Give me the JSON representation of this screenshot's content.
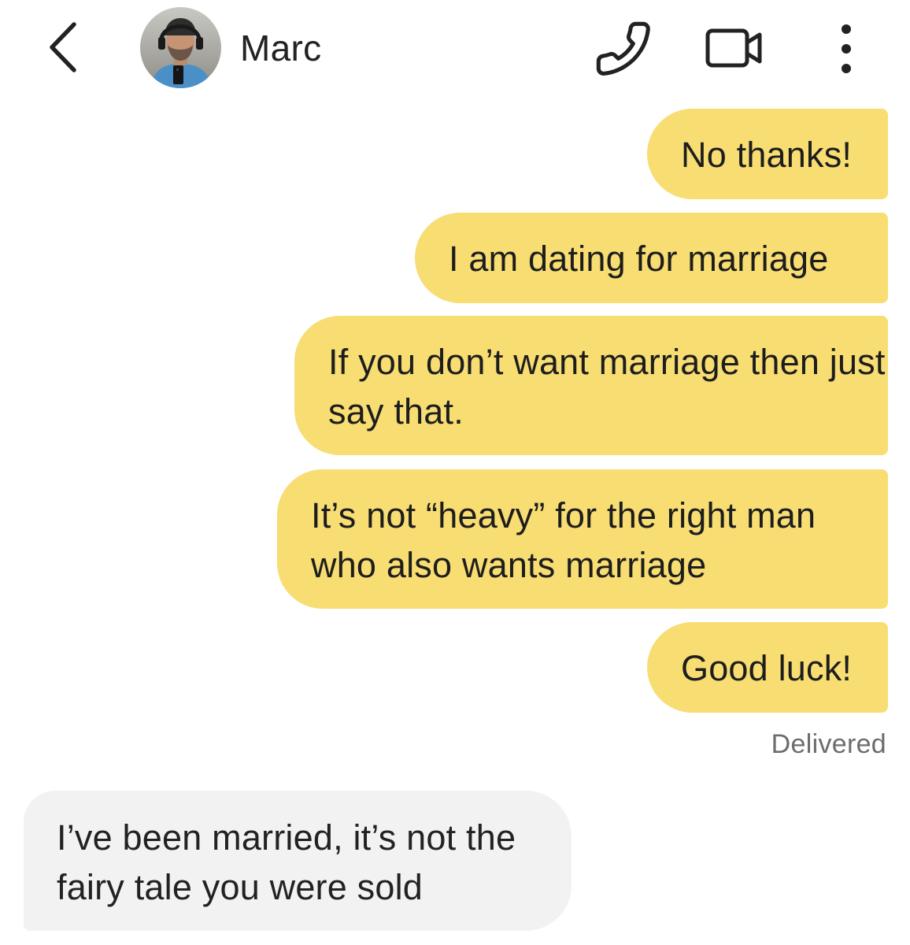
{
  "header": {
    "contact_name": "Marc",
    "icons": {
      "back": "chevron-left-icon",
      "call": "phone-icon",
      "video": "video-camera-icon",
      "more": "more-vertical-icon"
    }
  },
  "messages": [
    {
      "direction": "outgoing",
      "text": "No thanks!"
    },
    {
      "direction": "outgoing",
      "text": "I am dating for marriage"
    },
    {
      "direction": "outgoing",
      "text": "If you don’t want marriage then just say that."
    },
    {
      "direction": "outgoing",
      "text": "It’s not “heavy” for the right man who also wants marriage"
    },
    {
      "direction": "outgoing",
      "text": "Good luck!"
    },
    {
      "direction": "incoming",
      "text": "I’ve been married, it’s not the fairy tale you were sold"
    }
  ],
  "delivery_status": "Delivered",
  "colors": {
    "outgoing_bubble": "#f7dd72",
    "incoming_bubble": "#f2f2f2",
    "text": "#1d1d1d",
    "status_text": "#6c6c6c"
  }
}
